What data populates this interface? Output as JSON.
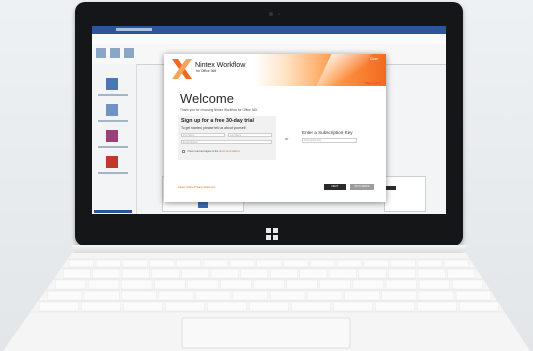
{
  "dialog": {
    "brand_name": "Nintex Workflow",
    "brand_sub": "for Office 365",
    "close_label": "Close",
    "page_indicator": "Page 1 of 3",
    "welcome_title": "Welcome",
    "welcome_sub": "Thank you for choosing Nintex Workflow for Office 365.",
    "signup_title": "Sign up for a free 30-day trial",
    "signup_sub": "To get started, please tell us about yourself.",
    "first_name_placeholder": "First Name",
    "last_name_placeholder": "Last Name",
    "email_placeholder": "Email Address",
    "terms_text": "I have read and agree to the",
    "terms_link": "terms & conditions",
    "or_label": "or",
    "subscription_title": "Enter a Subscription Key",
    "subscription_placeholder": "Subscription Key",
    "footer_link": "Nintex Online Privacy Statement",
    "next_label": "NEXT",
    "cancel_label": "NO THANKS"
  },
  "colors": {
    "accent": "#f26a1f",
    "ribbon": "#2b579a",
    "bezel": "#151617"
  }
}
